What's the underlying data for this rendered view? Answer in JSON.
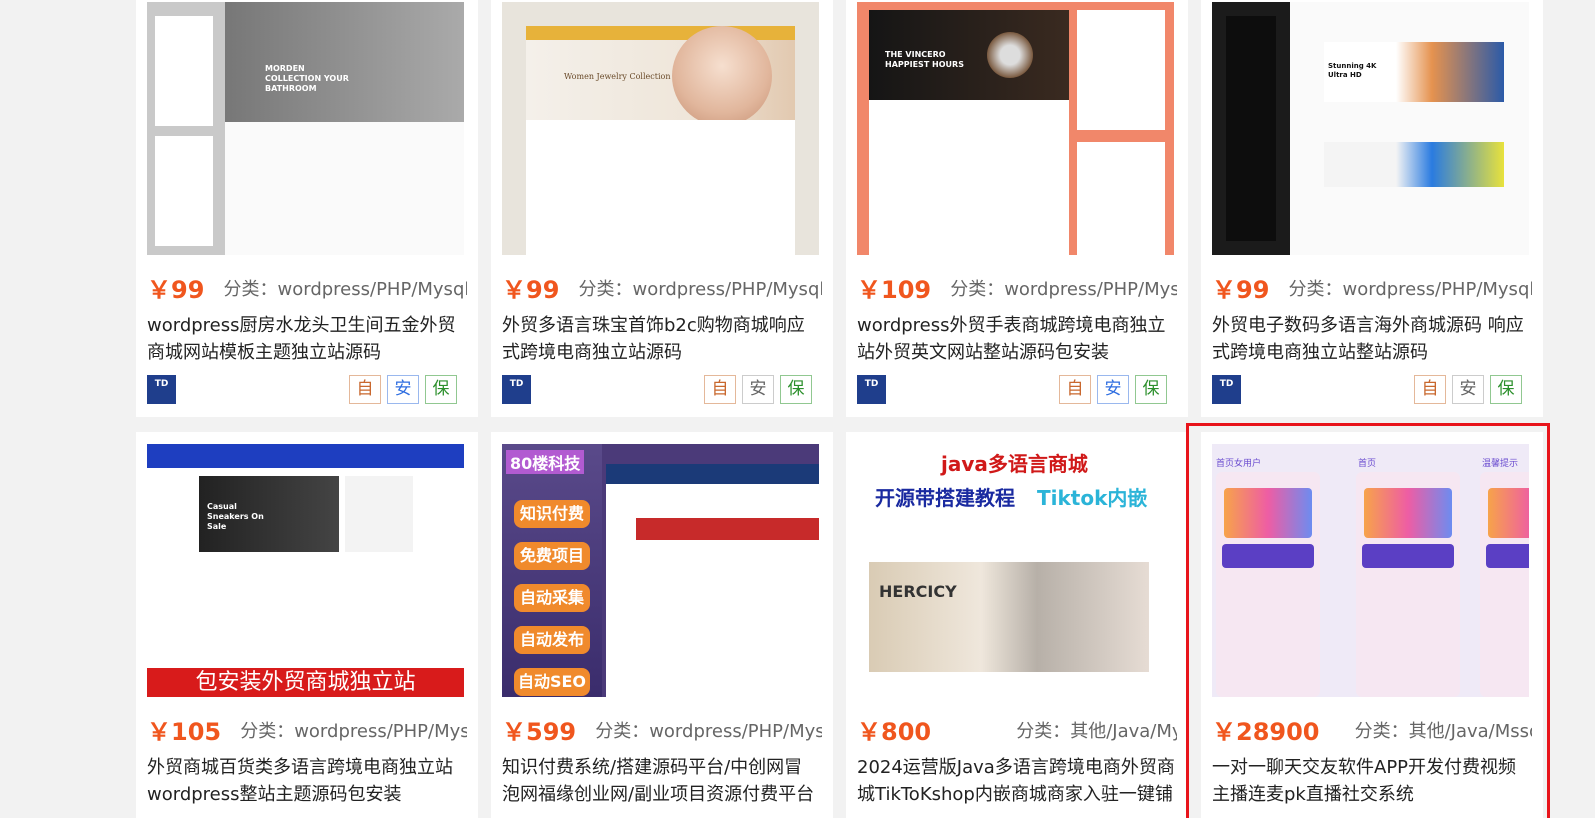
{
  "products": [
    {
      "price": "￥99",
      "category": "分类：wordpress/PHP/Mysql",
      "title": "wordpress厨房水龙头卫生间五金外贸商城网站模板主题独立站源码",
      "thumb_text": "MORDEN COLLECTION YOUR BATHROOM",
      "badge": "TD",
      "tags": [
        "自",
        "安",
        "保"
      ],
      "an_color": "blue"
    },
    {
      "price": "￥99",
      "category": "分类：wordpress/PHP/Mysql",
      "title": "外贸多语言珠宝首饰b2c购物商城响应式跨境电商独立站源码",
      "thumb_text": "Women Jewelry Collection",
      "badge": "TD",
      "tags": [
        "自",
        "安",
        "保"
      ],
      "an_color": "gray"
    },
    {
      "price": "￥109",
      "category": "分类：wordpress/PHP/Mysql",
      "title": "wordpress外贸手表商城跨境电商独立站外贸英文网站整站源码包安装",
      "thumb_text": "THE VINCERO HAPPIEST HOURS",
      "badge": "TD",
      "tags": [
        "自",
        "安",
        "保"
      ],
      "an_color": "blue"
    },
    {
      "price": "￥99",
      "category": "分类：wordpress/PHP/Mysql",
      "title": "外贸电子数码多语言海外商城源码 响应式跨境电商独立站整站源码",
      "thumb_text": "Stunning 4K Ultra HD",
      "badge": "TD",
      "tags": [
        "自",
        "安",
        "保"
      ],
      "an_color": "gray"
    },
    {
      "price": "￥105",
      "category": "分类：wordpress/PHP/Mysql",
      "title": "外贸商城百货类多语言跨境电商独立站wordpress整站主题源码包安装",
      "thumb_text": "Casual Sneakers On Sale",
      "banner": "包安装外贸商城独立站"
    },
    {
      "price": "￥599",
      "category": "分类：wordpress/PHP/Mysql",
      "title": "知识付费系统/搭建源码平台/中创网冒泡网福缘创业网/副业项目资源付费平台系",
      "top_text": "80楼科技",
      "pills": [
        "知识付费",
        "免费项目",
        "自动采集",
        "自动发布",
        "自动SEO"
      ]
    },
    {
      "price": "￥800",
      "category": "分类：其他/Java/Mysql",
      "title": "2024运营版Java多语言跨境电商外贸商城TikToKshop内嵌商城商家入驻一键铺",
      "thumb_line1": "java多语言商城",
      "thumb_line2": "开源带搭建教程",
      "thumb_line3": "Tiktok内嵌",
      "thumb_brand": "HERCICY"
    },
    {
      "price": "￥28900",
      "category": "分类：其他/Java/Mssql",
      "title": "一对一聊天交友软件APP开发付费视频主播连麦pk直播社交系统",
      "thumb_labels": [
        "首页女用户",
        "首页",
        "温馨提示"
      ]
    }
  ]
}
